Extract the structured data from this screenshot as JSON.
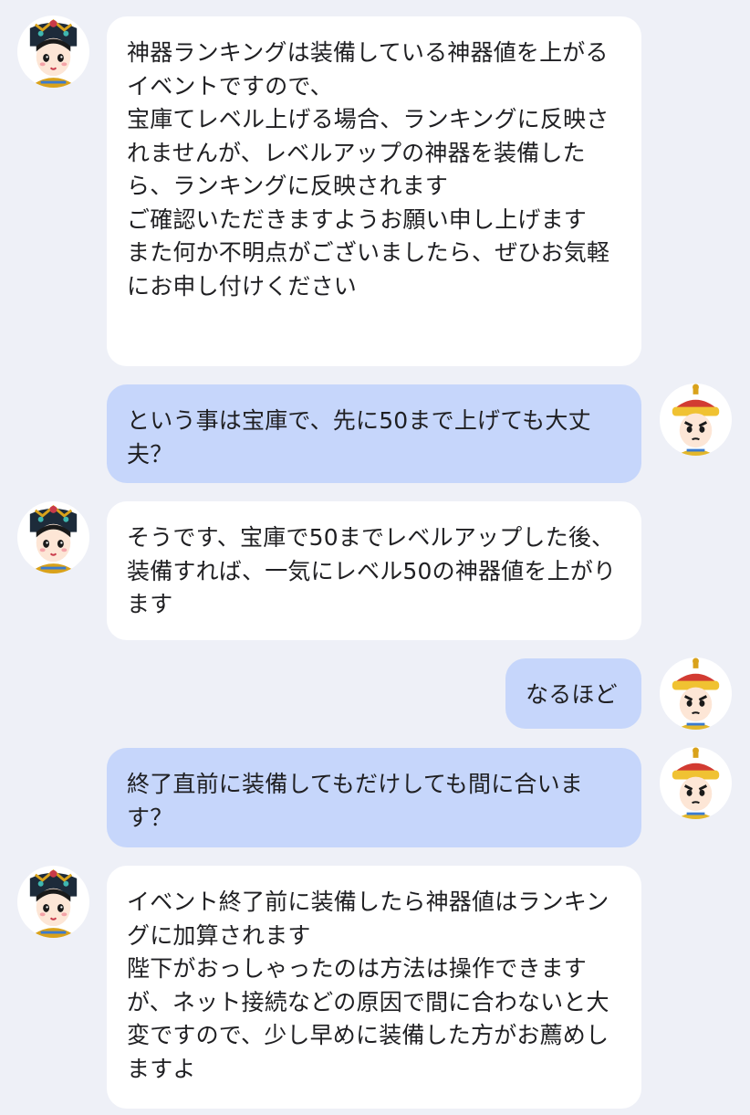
{
  "messages": [
    {
      "sender": "agent",
      "text": "神器ランキングは装備している神器値を上がるイベントですので、\n宝庫てレベル上げる場合、ランキングに反映されませんが、レベルアップの神器を装備したら、ランキングに反映されます\nご確認いただきますようお願い申し上げます\nまた何か不明点がございましたら、ぜひお気軽にお申し付けください",
      "avatar": "empress-avatar"
    },
    {
      "sender": "user",
      "text": "という事は宝庫で、先に50まで上げても大丈夫？",
      "avatar": "emperor-avatar"
    },
    {
      "sender": "agent",
      "text": "そうです、宝庫で50までレベルアップした後、装備すれば、一気にレベル50の神器値を上がります",
      "avatar": "empress-avatar"
    },
    {
      "sender": "user",
      "text": "なるほど",
      "avatar": "emperor-avatar"
    },
    {
      "sender": "user",
      "text": "終了直前に装備してもだけしても間に合います？",
      "avatar": "emperor-avatar"
    },
    {
      "sender": "agent",
      "text": "イベント終了前に装備したら神器値はランキングに加算されます\n陛下がおっしゃったのは方法は操作できますが、ネット接続などの原因で間に合わないと大変ですので、少し早めに装備した方がお薦めしますよ",
      "avatar": "empress-avatar"
    }
  ],
  "colors": {
    "background": "#eef0f7",
    "agent_bubble": "#ffffff",
    "user_bubble": "#c6d6fb",
    "text": "#1f1f22"
  }
}
